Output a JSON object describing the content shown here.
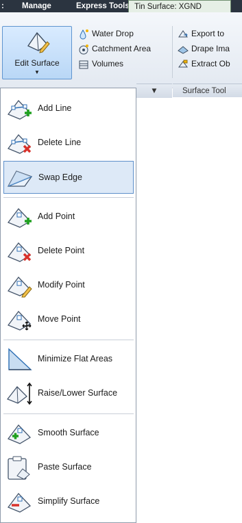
{
  "tabs": [
    {
      "label": ":"
    },
    {
      "label": "Manage"
    },
    {
      "label": "Express Tools"
    },
    {
      "label": "Tin Surface: XGND"
    }
  ],
  "ribbon": {
    "big_button": {
      "label": "Edit Surface",
      "arrow": "▼",
      "icon": "pencil-surface-icon"
    },
    "column1": [
      {
        "label": "Water Drop",
        "icon": "water-drop-icon"
      },
      {
        "label": "Catchment Area",
        "icon": "catchment-area-icon"
      },
      {
        "label": "Volumes",
        "icon": "volumes-icon"
      }
    ],
    "column2": [
      {
        "label": "Export to",
        "icon": "export-icon"
      },
      {
        "label": "Drape Ima",
        "icon": "drape-image-icon"
      },
      {
        "label": "Extract Ob",
        "icon": "extract-objects-icon"
      }
    ],
    "panel_arrow": "▼",
    "panel_title": "Surface Tool"
  },
  "menu": {
    "items": [
      {
        "label": "Add Line",
        "icon": "add-line-icon"
      },
      {
        "label": "Delete Line",
        "icon": "delete-line-icon"
      },
      {
        "label": "Swap Edge",
        "icon": "swap-edge-icon",
        "highlighted": true
      },
      {
        "label": "Add Point",
        "icon": "add-point-icon"
      },
      {
        "label": "Delete Point",
        "icon": "delete-point-icon"
      },
      {
        "label": "Modify Point",
        "icon": "modify-point-icon"
      },
      {
        "label": "Move Point",
        "icon": "move-point-icon"
      },
      {
        "label": "Minimize Flat Areas",
        "icon": "minimize-flat-areas-icon"
      },
      {
        "label": "Raise/Lower Surface",
        "icon": "raise-lower-surface-icon"
      },
      {
        "label": "Smooth Surface",
        "icon": "smooth-surface-icon"
      },
      {
        "label": "Paste Surface",
        "icon": "paste-surface-icon"
      },
      {
        "label": "Simplify Surface",
        "icon": "simplify-surface-icon"
      }
    ]
  },
  "colors": {
    "tab_bar": "#2b3440",
    "active_tab": "#e6efe6",
    "highlight": "#dde9f7",
    "highlight_border": "#5d8fca",
    "add_green": "#1fa01f",
    "delete_red": "#d8322b"
  }
}
